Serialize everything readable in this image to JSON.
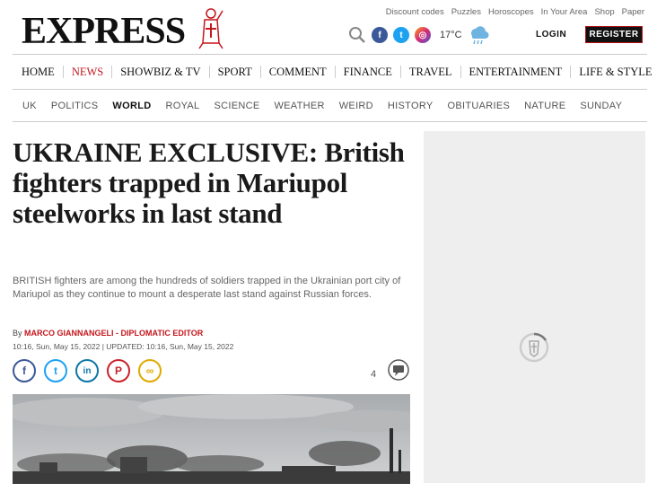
{
  "brand": {
    "logo_text": "EXPRESS"
  },
  "top_links": [
    "Discount codes",
    "Puzzles",
    "Horoscopes",
    "In Your Area",
    "Shop",
    "Paper"
  ],
  "weather": {
    "temperature": "17°C"
  },
  "account": {
    "login_label": "LOGIN",
    "register_label": "REGISTER"
  },
  "main_nav": [
    {
      "label": "HOME",
      "active": false
    },
    {
      "label": "NEWS",
      "active": true
    },
    {
      "label": "SHOWBIZ & TV",
      "active": false
    },
    {
      "label": "SPORT",
      "active": false
    },
    {
      "label": "COMMENT",
      "active": false
    },
    {
      "label": "FINANCE",
      "active": false
    },
    {
      "label": "TRAVEL",
      "active": false
    },
    {
      "label": "ENTERTAINMENT",
      "active": false
    },
    {
      "label": "LIFE & STYLE",
      "active": false
    }
  ],
  "sub_nav": [
    {
      "label": "UK",
      "active": false
    },
    {
      "label": "POLITICS",
      "active": false
    },
    {
      "label": "WORLD",
      "active": true
    },
    {
      "label": "ROYAL",
      "active": false
    },
    {
      "label": "SCIENCE",
      "active": false
    },
    {
      "label": "WEATHER",
      "active": false
    },
    {
      "label": "WEIRD",
      "active": false
    },
    {
      "label": "HISTORY",
      "active": false
    },
    {
      "label": "OBITUARIES",
      "active": false
    },
    {
      "label": "NATURE",
      "active": false
    },
    {
      "label": "SUNDAY",
      "active": false
    }
  ],
  "article": {
    "headline": "UKRAINE EXCLUSIVE: British fighters trapped in Mariupol steelworks in last stand",
    "lead": "BRITISH fighters are among the hundreds of soldiers trapped in the Ukrainian port city of Mariupol as they continue to mount a desperate last stand against Russian forces.",
    "byline_prefix": "By",
    "author": "MARCO GIANNANGELI - DIPLOMATIC EDITOR",
    "dates": "10:16, Sun, May 15, 2022 | UPDATED: 10:16, Sun, May 15, 2022",
    "comment_count": "4"
  },
  "share_icons": [
    {
      "name": "facebook-icon",
      "glyph": "f",
      "color": "#3b5998"
    },
    {
      "name": "twitter-icon",
      "glyph": "t",
      "color": "#1da1f2"
    },
    {
      "name": "linkedin-icon",
      "glyph": "in",
      "color": "#0e76a8"
    },
    {
      "name": "pinterest-icon",
      "glyph": "P",
      "color": "#c8232c"
    },
    {
      "name": "link-icon",
      "glyph": "∞",
      "color": "#e0a800"
    }
  ],
  "colors": {
    "accent": "#c4161c",
    "ad_bg": "#eeeeee"
  }
}
